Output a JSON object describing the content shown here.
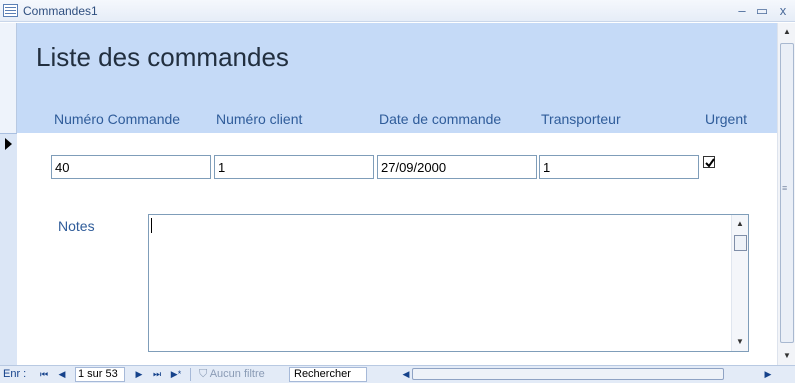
{
  "window": {
    "title": "Commandes1",
    "minimize": "–",
    "maximize": "▭",
    "close": "x"
  },
  "header": {
    "title": "Liste des commandes",
    "columns": {
      "order_number": "Numéro Commande",
      "client_number": "Numéro client",
      "order_date": "Date de commande",
      "carrier": "Transporteur",
      "urgent": "Urgent"
    }
  },
  "record": {
    "order_number": "40",
    "client_number": "1",
    "order_date": "27/09/2000",
    "carrier": "1",
    "urgent_checked": true,
    "notes_label": "Notes",
    "notes_value": ""
  },
  "navigation": {
    "label": "Enr :",
    "first": "⏮",
    "prev": "◀",
    "current": "1 sur 53",
    "next": "▶",
    "last": "⏭",
    "new": "▶*",
    "filter": "Aucun filtre",
    "search": "Rechercher"
  },
  "colors": {
    "header_bg": "#c5daf7",
    "label": "#2f5c9a"
  }
}
